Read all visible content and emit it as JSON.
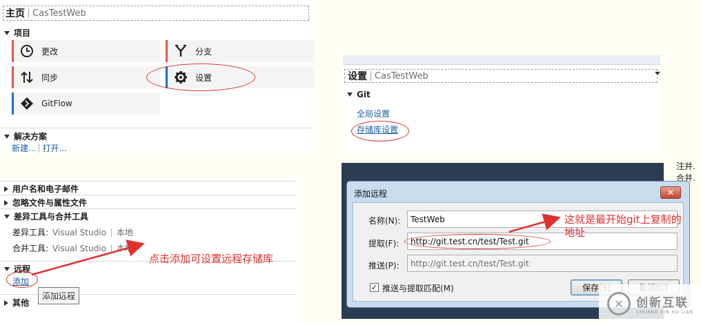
{
  "home": {
    "title": "主页",
    "subtitle": "CasTestWeb",
    "projects_title": "项目",
    "tiles": [
      {
        "label": "更改",
        "icon": "clock-icon",
        "color": "#e05a47"
      },
      {
        "label": "分支",
        "icon": "branch-icon",
        "color": "#e05a47"
      },
      {
        "label": "同步",
        "icon": "sync-arrows-icon",
        "color": "#e05a47"
      },
      {
        "label": "设置",
        "icon": "gear-icon",
        "color": "#1e6fb8"
      },
      {
        "label": "GitFlow",
        "icon": "gitflow-icon",
        "color": "#1e6fb8"
      }
    ],
    "solutions_title": "解决方案",
    "new_link": "新建...",
    "open_link": "打开..."
  },
  "settings": {
    "title": "设置",
    "subtitle": "CasTestWeb",
    "git_title": "Git",
    "global_settings": "全局设置",
    "repo_settings": "存储库设置"
  },
  "repo_sections": {
    "user_email": "用户名和电子邮件",
    "ignore_files": "忽略文件与属性文件",
    "diff_merge": "差异工具与合并工具",
    "diff_tool_label": "差异工具:",
    "diff_tool_value": "Visual Studio",
    "diff_tool_scope": "本地",
    "merge_tool_label": "合并工具:",
    "merge_tool_value": "Visual Studio",
    "merge_tool_scope": "本地",
    "remotes": "远程",
    "add_link": "添加",
    "tooltip": "添加远程",
    "other": "其他"
  },
  "dialog": {
    "title": "添加远程",
    "close": "✕",
    "name_label": "名称(N):",
    "name_value": "TestWeb",
    "fetch_label": "提取(F):",
    "fetch_value": "http://git.test.cn/test/Test.git",
    "push_label": "推送(P):",
    "push_value": "http://git.test.cn/test/Test.git",
    "match_label": "推送与提取匹配(M)",
    "save": "保存(S)",
    "cancel": "取消(C)"
  },
  "annotations": {
    "add_hint": "点击添加可设置远程存储库",
    "url_hint_line1": "这就是最开始git上复制的",
    "url_hint_line2": "地址"
  },
  "side_text": {
    "line1": "注并.",
    "line2": "合并."
  },
  "watermark": {
    "brand": "创新互联",
    "pinyin": "CHUANG XIN HU LIAN"
  },
  "colors": {
    "accent_red": "#e05a47",
    "accent_blue": "#1e6fb8",
    "annotation_red": "#e03030",
    "link_blue": "#1e5faa"
  }
}
